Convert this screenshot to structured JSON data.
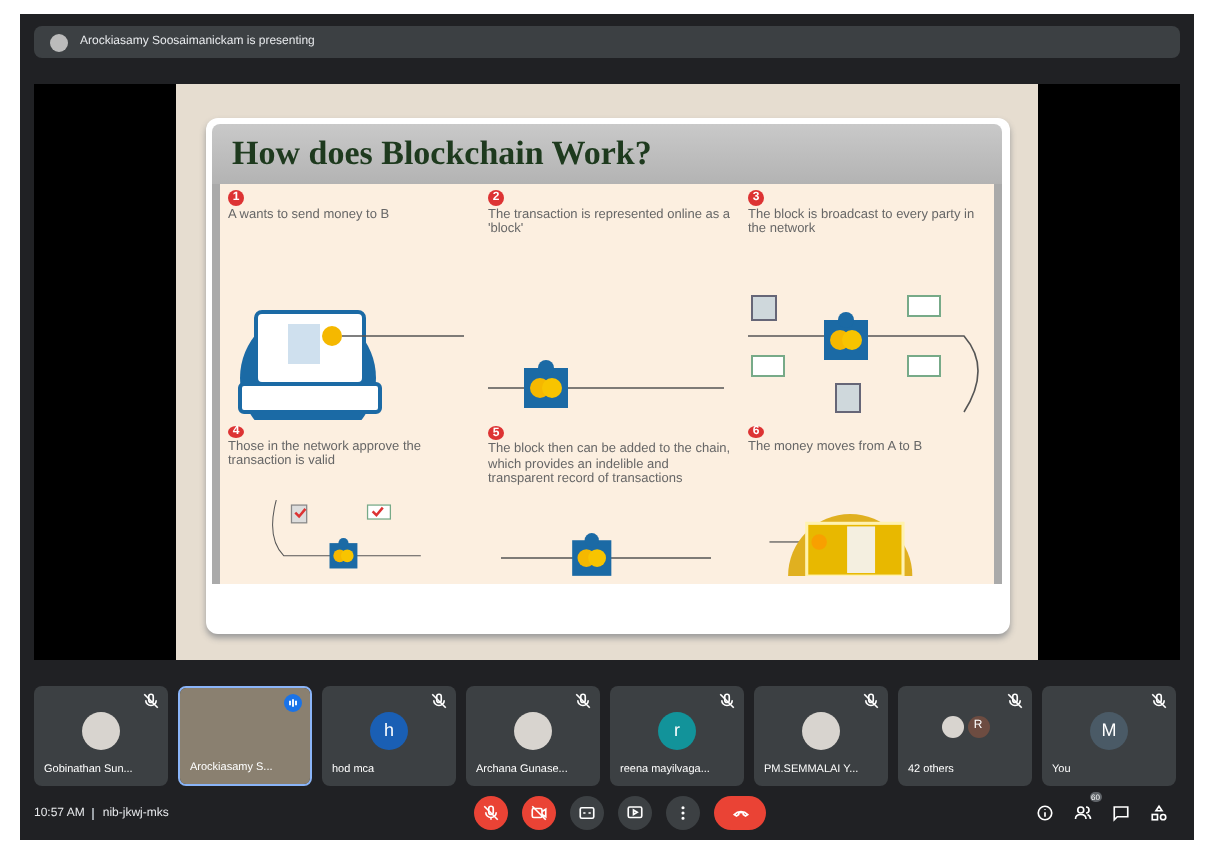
{
  "presenting_bar": {
    "text": "Arockiasamy Soosaimanickam is presenting"
  },
  "slide": {
    "title": "How does Blockchain Work?",
    "steps": [
      {
        "number": "1",
        "text": "A wants to send money to B",
        "kind": "laptop"
      },
      {
        "number": "2",
        "text": "The transaction is represented online as a 'block'",
        "kind": "block"
      },
      {
        "number": "3",
        "text": "The block is broadcast to every party in the network",
        "kind": "broadcast"
      },
      {
        "number": "4",
        "text": "Those in the network approve the transaction is valid",
        "kind": "approve"
      },
      {
        "number": "5",
        "text": "The block then can be added to the chain, which provides an indelible and transparent record of transactions",
        "kind": "chain"
      },
      {
        "number": "6",
        "text": "The money moves from A to B",
        "kind": "wallet"
      }
    ]
  },
  "participants": [
    {
      "name": "Gobinathan Sun...",
      "kind": "photo",
      "muted": true
    },
    {
      "name": "Arockiasamy S...",
      "kind": "video",
      "muted": false
    },
    {
      "name": "hod mca",
      "kind": "initial",
      "initial": "h",
      "color": "#1a5fb4",
      "muted": true
    },
    {
      "name": "Archana Gunase...",
      "kind": "photo",
      "muted": true
    },
    {
      "name": "reena mayilvaga...",
      "kind": "initial",
      "initial": "r",
      "color": "#12939a",
      "muted": true
    },
    {
      "name": "PM.SEMMALAI Y...",
      "kind": "photo",
      "muted": true
    },
    {
      "name": "42 others",
      "kind": "group",
      "initial": "R",
      "muted": true
    },
    {
      "name": "You",
      "kind": "initial",
      "initial": "M",
      "color": "#4a5a66",
      "muted": true
    }
  ],
  "meeting": {
    "time": "10:57 AM",
    "code": "nib-jkwj-mks"
  },
  "controls": [
    {
      "kind": "mic",
      "on": false
    },
    {
      "kind": "camera",
      "on": false
    },
    {
      "kind": "captions",
      "on": true
    },
    {
      "kind": "present",
      "on": true
    },
    {
      "kind": "more",
      "on": true
    },
    {
      "kind": "hangup"
    }
  ],
  "side_controls": [
    {
      "kind": "info"
    },
    {
      "kind": "people",
      "badge": "60"
    },
    {
      "kind": "chat"
    },
    {
      "kind": "activities"
    }
  ]
}
